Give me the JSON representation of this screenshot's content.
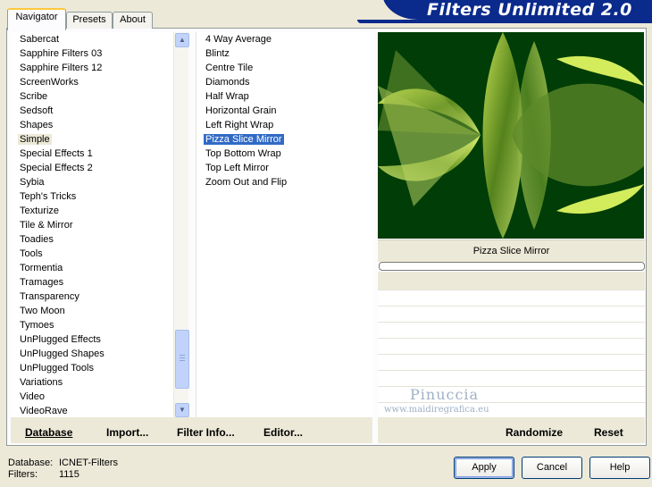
{
  "header": {
    "title": "Filters Unlimited 2.0"
  },
  "tabs": [
    {
      "label": "Navigator",
      "active": true
    },
    {
      "label": "Presets",
      "active": false
    },
    {
      "label": "About",
      "active": false
    }
  ],
  "categories": [
    "Sabercat",
    "Sapphire Filters 03",
    "Sapphire Filters 12",
    "ScreenWorks",
    "Scribe",
    "Sedsoft",
    "Shapes",
    "Simple",
    "Special Effects 1",
    "Special Effects 2",
    "Sybia",
    "Teph's Tricks",
    "Texturize",
    "Tile & Mirror",
    "Toadies",
    "Tools",
    "Tormentia",
    "Tramages",
    "Transparency",
    "Two Moon",
    "Tymoes",
    "UnPlugged Effects",
    "UnPlugged Shapes",
    "UnPlugged Tools",
    "Variations",
    "Video",
    "VideoRave"
  ],
  "selected_category": "Simple",
  "filters": [
    "4 Way Average",
    "Blintz",
    "Centre Tile",
    "Diamonds",
    "Half Wrap",
    "Horizontal Grain",
    "Left Right Wrap",
    "Pizza Slice Mirror",
    "Top Bottom Wrap",
    "Top Left Mirror",
    "Zoom Out and Flip"
  ],
  "selected_filter": "Pizza Slice Mirror",
  "preview": {
    "filter_name": "Pizza Slice Mirror",
    "background_color": "#003D07"
  },
  "watermark": {
    "name": "Pinuccia",
    "url": "www.maidiregrafica.eu"
  },
  "toolbar": {
    "database": "Database",
    "import": "Import...",
    "filter_info": "Filter Info...",
    "editor": "Editor...",
    "randomize": "Randomize",
    "reset": "Reset"
  },
  "status": {
    "database_label": "Database:",
    "database_value": "ICNET-Filters",
    "filters_label": "Filters:",
    "filters_value": "1115"
  },
  "buttons": {
    "apply": "Apply",
    "cancel": "Cancel",
    "help": "Help"
  },
  "colors": {
    "banner": "#0A2A8C",
    "selection": "#316AC5",
    "window": "#ECE9D8"
  }
}
